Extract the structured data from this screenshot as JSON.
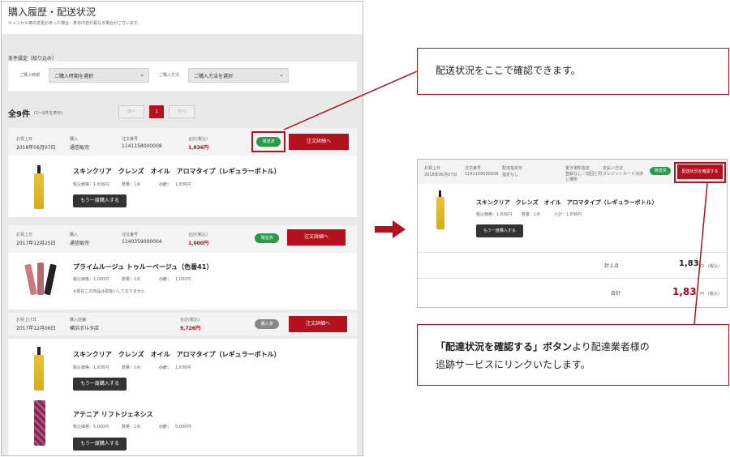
{
  "left": {
    "page_title": "購入履歴・配送状況",
    "note": "キャンセル等の変更があった場合、表示内容が異なる場合がございます。",
    "filter": {
      "heading": "条件設定（絞り込み）",
      "period_label": "ご購入時期",
      "period_value": "ご購入時期を選択",
      "method_label": "ご購入方法",
      "method_value": "ご購入方法を選択"
    },
    "count_label": "全9件",
    "count_sub": "(1～9件を表示)",
    "pager": {
      "prev": "前へ",
      "current": "1",
      "next": "次へ"
    },
    "orders": [
      {
        "date_label": "お買上日",
        "date": "2018年06月07日",
        "channel_label": "購入",
        "channel": "通信販売",
        "number_label": "注文番号",
        "number": "1141158000008",
        "total_label": "合計(税込)",
        "total": "1,836円",
        "status": "発送済",
        "detail_button": "注文詳細へ",
        "items": [
          {
            "name": "スキンクリア　クレンズ　オイル　アロマタイプ（レギュラーボトル）",
            "price": "税込価格：1,836円",
            "qty": "数量：1点",
            "subtotal_label": "小計：",
            "subtotal": "1,836円",
            "rebuy": "もう一度購入する"
          }
        ]
      },
      {
        "date_label": "お買上日",
        "date": "2017年12月25日",
        "channel_label": "購入",
        "channel": "通信販売",
        "number_label": "注文番号",
        "number": "1140359000004",
        "total_label": "合計(税込)",
        "total": "1,000円",
        "status": "発送済",
        "detail_button": "注文詳細へ",
        "items": [
          {
            "name": "プライムルージュ トゥルーベージュ（色番41）",
            "price": "税込価格：1,000円",
            "qty": "数量：1点",
            "subtotal_label": "小計：",
            "subtotal": "1,000円",
            "notice": "※現在この商品は取扱いしておりません"
          }
        ]
      },
      {
        "date_label": "お買上げ日",
        "date": "2017年12月06日",
        "channel_label": "購入店舗",
        "channel": "横浜ポルタ店",
        "total_label": "合計(税込)",
        "total": "9,726円",
        "status": "購入済",
        "detail_button": "注文詳細へ",
        "items": [
          {
            "name": "スキンクリア　クレンズ　オイル　アロマタイプ（レギュラーボトル）",
            "price": "税込価格：1,836円",
            "qty": "数量：1点",
            "subtotal_label": "小計：",
            "subtotal": "1,836円",
            "rebuy": "もう一度購入する"
          },
          {
            "name": "アテニア リフトジェネシス",
            "price": "税込価格：5,000円",
            "qty": "数量：1点",
            "subtotal_label": "小計：",
            "subtotal": "5,000円",
            "rebuy": "もう一度購入する"
          }
        ]
      }
    ]
  },
  "right": {
    "cols": {
      "date_label": "お買上日",
      "date": "2018年06月07日",
      "number_label": "注文番号",
      "number": "1141158000008",
      "delivery_label": "配達指定日",
      "delivery": "指定なし",
      "place_label": "置き場所指定",
      "place": "登録なし／前回と同じ場所",
      "pay_label": "支払い方法",
      "pay": "クレジットカード決済"
    },
    "status": "発送済",
    "confirm_button": "配送状況を確認する",
    "item_name": "スキンクリア　クレンズ　オイル　アロマタイプ（レギュラーボトル）",
    "price": "税込価格：1,836円",
    "qty": "数量：1点",
    "subtotal": "小計：1,836円",
    "rebuy": "もう一度購入する",
    "count_label": "計１点",
    "count_value": "1,83",
    "total_label": "合計",
    "total_value": "1,83",
    "yen": "円",
    "tax": "(税込)"
  },
  "callout_top": "配送状況をここで確認できます。",
  "callout_bottom": {
    "bold": "「配達状況を確認する」ボタン",
    "rest": "より配達業者様の",
    "line2": "追跡サービスにリンクいたします。"
  },
  "colors": {
    "accent": "#b4101e",
    "status_green": "#2a9a48"
  }
}
